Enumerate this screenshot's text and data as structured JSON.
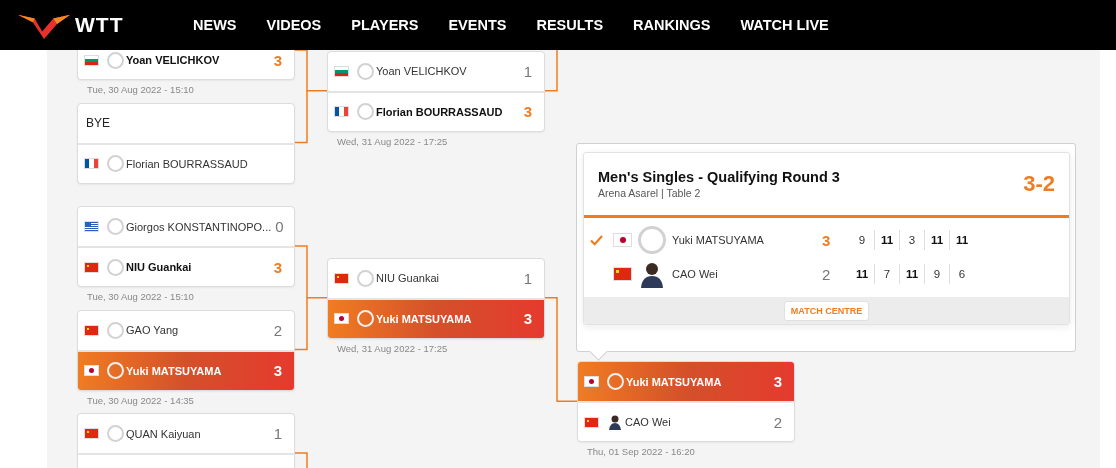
{
  "header": {
    "logo_text": "WTT",
    "nav": [
      {
        "label": "NEWS"
      },
      {
        "label": "VIDEOS"
      },
      {
        "label": "PLAYERS"
      },
      {
        "label": "EVENTS"
      },
      {
        "label": "RESULTS"
      },
      {
        "label": "RANKINGS"
      },
      {
        "label": "WATCH LIVE"
      }
    ]
  },
  "rounds": [
    {
      "matches": [
        {
          "top_cut": true,
          "date": "Tue, 30 Aug 2022 - 15:10",
          "players": [
            {
              "kind": "player",
              "flag": {
                "kind": "bg"
              },
              "has_photo": false,
              "name": "Yoan VELICHKOV",
              "score": "3",
              "winner": true,
              "highlighted": false
            }
          ]
        },
        {
          "players": [
            {
              "kind": "bye",
              "name": "BYE"
            },
            {
              "kind": "player",
              "flag": {
                "kind": "fr"
              },
              "has_photo": false,
              "name": "Florian BOURRASSAUD",
              "winner": false,
              "highlighted": false
            }
          ]
        },
        {
          "date": "Tue, 30 Aug 2022 - 15:10",
          "players": [
            {
              "kind": "player",
              "flag": {
                "kind": "gr"
              },
              "has_photo": false,
              "name": "Giorgos KONSTANTINOPO...",
              "score": "0",
              "winner": false,
              "highlighted": false
            },
            {
              "kind": "player",
              "flag": {
                "kind": "cn"
              },
              "has_photo": false,
              "name": "NIU Guankai",
              "score": "3",
              "winner": true,
              "highlighted": false
            }
          ]
        },
        {
          "date": "Tue, 30 Aug 2022 - 14:35",
          "players": [
            {
              "kind": "player",
              "flag": {
                "kind": "cn"
              },
              "has_photo": false,
              "name": "GAO Yang",
              "score": "2",
              "winner": false,
              "highlighted": false
            },
            {
              "kind": "player",
              "flag": {
                "kind": "jp"
              },
              "has_photo": false,
              "name": "Yuki MATSUYAMA",
              "score": "3",
              "winner": true,
              "highlighted": true
            }
          ]
        },
        {
          "bottom_cut": true,
          "players": [
            {
              "kind": "player",
              "flag": {
                "kind": "cn"
              },
              "has_photo": false,
              "name": "QUAN Kaiyuan",
              "score": "1",
              "winner": false,
              "highlighted": false
            }
          ]
        }
      ]
    },
    {
      "matches": [
        {
          "date": "Wed, 31 Aug 2022 - 17:25",
          "players": [
            {
              "kind": "player",
              "flag": {
                "kind": "bg"
              },
              "has_photo": false,
              "name": "Yoan VELICHKOV",
              "score": "1",
              "winner": false,
              "highlighted": false
            },
            {
              "kind": "player",
              "flag": {
                "kind": "fr"
              },
              "has_photo": false,
              "name": "Florian BOURRASSAUD",
              "score": "3",
              "winner": true,
              "highlighted": false
            }
          ]
        },
        {
          "date": "Wed, 31 Aug 2022 - 17:25",
          "players": [
            {
              "kind": "player",
              "flag": {
                "kind": "cn"
              },
              "has_photo": false,
              "name": "NIU Guankai",
              "score": "1",
              "winner": false,
              "highlighted": false
            },
            {
              "kind": "player",
              "flag": {
                "kind": "jp"
              },
              "has_photo": false,
              "name": "Yuki MATSUYAMA",
              "score": "3",
              "winner": true,
              "highlighted": true
            }
          ]
        }
      ]
    },
    {
      "matches": [
        {
          "date": "Thu, 01 Sep 2022 - 16:20",
          "players": [
            {
              "kind": "player",
              "flag": {
                "kind": "jp"
              },
              "has_photo": false,
              "name": "Yuki MATSUYAMA",
              "score": "3",
              "winner": true,
              "highlighted": true
            },
            {
              "kind": "player",
              "flag": {
                "kind": "cn"
              },
              "has_photo": true,
              "name": "CAO Wei",
              "score": "2",
              "winner": false,
              "highlighted": false
            }
          ]
        }
      ]
    }
  ],
  "popup": {
    "title": "Men's Singles - Qualifying Round 3",
    "venue": "Arena Asarel | Table 2",
    "score": "3-2",
    "button": "MATCH CENTRE",
    "players": [
      {
        "flag": {
          "kind": "jp"
        },
        "has_photo": false,
        "name": "Yuki MATSUYAMA",
        "winner": true,
        "score": "3",
        "games": [
          {
            "points": "9",
            "won": false
          },
          {
            "points": "11",
            "won": true
          },
          {
            "points": "3",
            "won": false
          },
          {
            "points": "11",
            "won": true
          },
          {
            "points": "11",
            "won": true
          }
        ]
      },
      {
        "flag": {
          "kind": "cn"
        },
        "has_photo": true,
        "name": "CAO Wei",
        "winner": false,
        "score": "2",
        "games": [
          {
            "points": "11",
            "won": true
          },
          {
            "points": "7",
            "won": false
          },
          {
            "points": "11",
            "won": true
          },
          {
            "points": "9",
            "won": false
          },
          {
            "points": "6",
            "won": false
          }
        ]
      }
    ]
  }
}
